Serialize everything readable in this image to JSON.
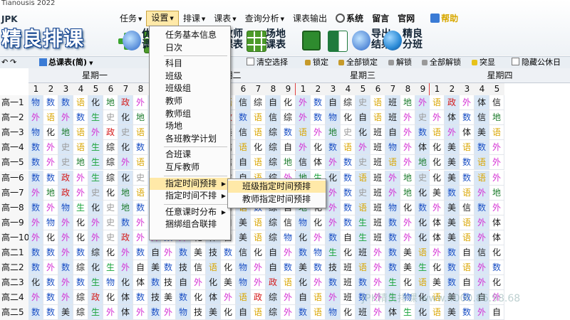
{
  "app": {
    "title_strip": "Tianousis 2022",
    "brand_small": "JPK",
    "brand_big": "精良排课"
  },
  "menubar": {
    "items": [
      {
        "label": "任务",
        "caret": true
      },
      {
        "label": "设置",
        "caret": true,
        "active": true
      },
      {
        "label": "排课",
        "caret": true
      },
      {
        "label": "课表",
        "caret": true
      },
      {
        "label": "查询分析",
        "caret": true
      },
      {
        "label": "课表输出",
        "caret": false
      },
      {
        "label": "系统",
        "caret": false,
        "icon": "gear-icon"
      },
      {
        "label": "留言",
        "caret": false
      },
      {
        "label": "官网",
        "caret": false
      },
      {
        "label": "帮助",
        "caret": false,
        "icon": "book-icon"
      }
    ]
  },
  "toolbar": {
    "items": [
      {
        "label": "优化调节",
        "icon": "tune-icon",
        "color": "#2a66c8"
      },
      {
        "label": "班级课表",
        "icon": "class-table-icon",
        "color": "#4c9a2a"
      },
      {
        "label": "教师课表",
        "icon": "teacher-table-icon",
        "color": "#4c9a2a"
      },
      {
        "label": "场地课表",
        "icon": "room-table-icon",
        "color": "#4c9a2a"
      },
      {
        "label": "",
        "icon": "save-icon",
        "color": "#2e8b2e"
      },
      {
        "label": "",
        "icon": "excel-icon",
        "color": "#1f7a3c"
      },
      {
        "label": "导出结果",
        "icon": "export-icon",
        "color": "#2a66c8"
      },
      {
        "label": "精良分班",
        "icon": "globe-icon",
        "color": "#2a8ad6"
      }
    ]
  },
  "optbar": {
    "view_label": "总课表(简)",
    "clear_label": "清空选择",
    "lock_label": "锁定",
    "lock_all_label": "全部锁定",
    "unlock_label": "解锁",
    "unlock_all_label": "全部解锁",
    "highlight_label": "突显",
    "hide_public_label": "隐藏公休日"
  },
  "settings_menu": {
    "items": [
      "任务基本信息",
      "日次",
      "科目",
      "班级",
      "班级组",
      "教师",
      "教师组",
      "场地",
      "各班教学计划",
      "合班课",
      "互斥教师",
      "指定时间预排",
      "指定时间不排",
      "任意课时分布",
      "捆绑组合联排"
    ],
    "highlighted": "指定时间预排"
  },
  "submenu": {
    "items": [
      "班级指定时间预排",
      "教师指定时间预排"
    ],
    "highlighted": "班级指定时间预排"
  },
  "timetable": {
    "days": [
      "星期一",
      "星期二",
      "星期三",
      "星期四"
    ],
    "periods": [
      "1",
      "2",
      "3",
      "4",
      "5",
      "6",
      "7",
      "8",
      "9"
    ],
    "rows": [
      {
        "label": "高一1",
        "cells": "物数数语化地政外物化外数美语信综自化外数自综史语班地外语政外体信数数自综"
      },
      {
        "label": "高一2",
        "cells": "外语外数生史化地化自物美语政数语信综外数物化自语班外史外体数信地物化数综"
      },
      {
        "label": "高一3",
        "cells": "物化地语外政史语外外史数外美信语综数语外地史化班自外数语外体美语自化数综"
      },
      {
        "label": "高一4",
        "cells": "数外史语生综化数外物自体美信语化综自外化数语外班物外体化美语数外物化外综"
      },
      {
        "label": "高一5",
        "cells": "数外史地生综外语外外数体美信自语综地信体外数史班语外地化美数语外地数体综"
      },
      {
        "label": "高一6",
        "cells": "数数政外生综化史外地外体美信自语综外地生化数语班外地史化美数语外地数体综"
      },
      {
        "label": "高一7",
        "cells": "外地政外史化地语外外地体美自语外综自化物外数史班外地化美数语外地数体化综"
      },
      {
        "label": "高一8",
        "cells": "数外物生化史地数外化外体美自语数综自地化外数语班物化数外美信数外体地数综"
      },
      {
        "label": "高一9",
        "cells": "外物外化外史数外外数外化体自美语综信物化外数生班数外化体美语外体地化数综"
      },
      {
        "label": "高一10",
        "cells": "外化外化外史政外外数外化体自美语综物化外数自生班数外化体美语外体信地化综"
      },
      {
        "label": "高二1",
        "cells": "数数外数综化外数自外数美技数信化自外数物生化班外数美语外数自信化数外综"
      },
      {
        "label": "高二2",
        "cells": "数外数综化生外自美数技信语化物外自数美数技班语外数美生化数语外数体化综"
      },
      {
        "label": "高二3",
        "cells": "化数外数生物化体数技自外化美物外政语化外数班数外生化语美数自外化数体综"
      },
      {
        "label": "高二4",
        "cells": "外数外综政化体数技美数化体外语政综外自语外班数外生物化语美数自外化数综"
      },
      {
        "label": "高二5",
        "cells": "数数美综生外体外数外物技美化自语综外数语物化班外体生化语美数外自化数综"
      }
    ],
    "subject_colors": {
      "数": "#1a4fc4",
      "外": "#d42fd4",
      "物": "#1a4fc4",
      "化": "#1a1a1a",
      "语": "#d9a500",
      "地": "#1a7a2a",
      "史": "#9a9a9a",
      "政": "#d41a1a",
      "生": "#19a33a",
      "综": "#1a1a1a",
      "美": "#1a1a1a",
      "信": "#1a1a1a",
      "体": "#1a1a1a",
      "自": "#1a1a1a",
      "技": "#1a1a1a",
      "班": "#1a1a1a"
    },
    "row_bg_odd": "#d9e7f6",
    "row_bg_even": "#ffffff"
  },
  "watermark": "JPK精良排课 www.4000.86.98.68"
}
